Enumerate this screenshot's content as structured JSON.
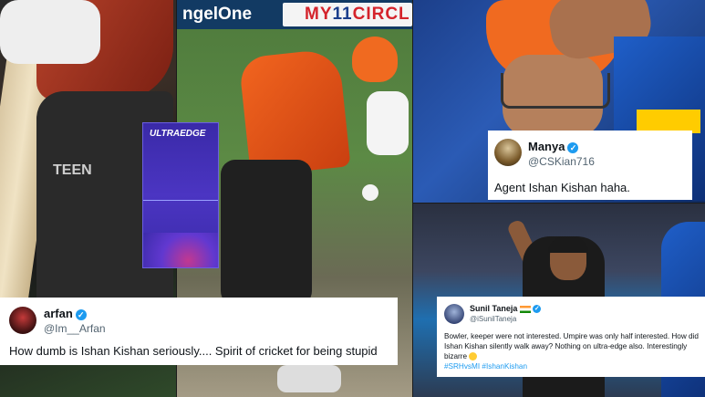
{
  "hoarding": {
    "sponsor_left": "ngelOne",
    "sponsor_right_prefix": "MY",
    "sponsor_right_number": "11",
    "sponsor_right_suffix": "CIRCL"
  },
  "left_panel": {
    "pad_logo": "TEEN"
  },
  "ultraedge": {
    "title": "ULTRAEDGE"
  },
  "tweets": [
    {
      "name": "arfan",
      "handle": "@Im__Arfan",
      "verified": true,
      "text": "How dumb is Ishan Kishan seriously.... Spirit of cricket for being stupid"
    },
    {
      "name": "Manya",
      "handle": "@CSKian716",
      "verified": true,
      "text": "Agent Ishan Kishan haha."
    },
    {
      "name": "Sunil Taneja",
      "handle": "@iSunilTaneja",
      "verified": true,
      "text": "Bowler, keeper were not interested. Umpire was only half interested. How did Ishan Kishan silently walk away? Nothing on ultra-edge also. Interestingly bizarre",
      "hashtags": "#SRHvsMI #IshanKishan"
    }
  ],
  "colors": {
    "verified_badge": "#1d9bf0",
    "srh_orange": "#f06a20",
    "mi_blue": "#1f5fc9",
    "ultraedge_purple": "#4b35c2"
  }
}
